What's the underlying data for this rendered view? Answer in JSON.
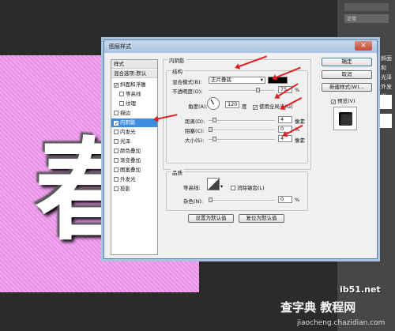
{
  "right_panel": {
    "mode": "正常",
    "labels": [
      "斜面和",
      "光泽",
      "外发光"
    ]
  },
  "watermark": {
    "main": "查字典 教程网",
    "site": "ib51.net",
    "url": "jiaocheng.chazidian.com"
  },
  "canvas": {
    "char": "春"
  },
  "dialog": {
    "title": "图层样式",
    "close": "✕",
    "styles_list": [
      {
        "label": "样式",
        "checkbox": false,
        "checked": false,
        "selected": false,
        "head": true
      },
      {
        "label": "混合选项:默认",
        "checkbox": false,
        "checked": false,
        "selected": false,
        "head": true
      },
      {
        "label": "斜面和浮雕",
        "checkbox": true,
        "checked": true,
        "selected": false
      },
      {
        "label": "等高线",
        "checkbox": true,
        "checked": false,
        "selected": false,
        "indent": true
      },
      {
        "label": "纹理",
        "checkbox": true,
        "checked": false,
        "selected": false,
        "indent": true
      },
      {
        "label": "描边",
        "checkbox": true,
        "checked": false,
        "selected": false
      },
      {
        "label": "内阴影",
        "checkbox": true,
        "checked": true,
        "selected": true
      },
      {
        "label": "内发光",
        "checkbox": true,
        "checked": false,
        "selected": false
      },
      {
        "label": "光泽",
        "checkbox": true,
        "checked": false,
        "selected": false
      },
      {
        "label": "颜色叠加",
        "checkbox": true,
        "checked": false,
        "selected": false
      },
      {
        "label": "渐变叠加",
        "checkbox": true,
        "checked": false,
        "selected": false
      },
      {
        "label": "图案叠加",
        "checkbox": true,
        "checked": false,
        "selected": false
      },
      {
        "label": "外发光",
        "checkbox": true,
        "checked": false,
        "selected": false
      },
      {
        "label": "投影",
        "checkbox": true,
        "checked": false,
        "selected": false
      }
    ],
    "inner_shadow": {
      "title": "内阴影",
      "structure_label": "结构",
      "blend_mode_label": "混合模式(B):",
      "blend_mode": "正片叠底",
      "shadow_color": "#000000",
      "opacity_label": "不透明度(O):",
      "opacity": "75",
      "opacity_level": 0.75,
      "pct": "%",
      "angle_label": "角度(A):",
      "angle": "120",
      "degree": "度",
      "global_light_label": "使用全局光(G)",
      "global_light_checked": true,
      "distance_label": "距离(D):",
      "distance": "4",
      "distance_level": 0.06,
      "choke_label": "阻塞(C):",
      "choke": "0",
      "choke_level": 0.0,
      "size_label": "大小(S):",
      "size": "4",
      "size_level": 0.06,
      "px": "像素",
      "quality_label": "品质",
      "contour_label": "等高线:",
      "antialias_label": "消除锯齿(L)",
      "noise_label": "杂色(N):",
      "noise": "0",
      "noise_level": 0.0,
      "default_button": "设置为默认值",
      "reset_button": "复位为默认值"
    },
    "buttons": {
      "ok": "确定",
      "cancel": "取消",
      "new_style": "新建样式(W)...",
      "preview": "预览(V)",
      "preview_checked": true
    }
  }
}
